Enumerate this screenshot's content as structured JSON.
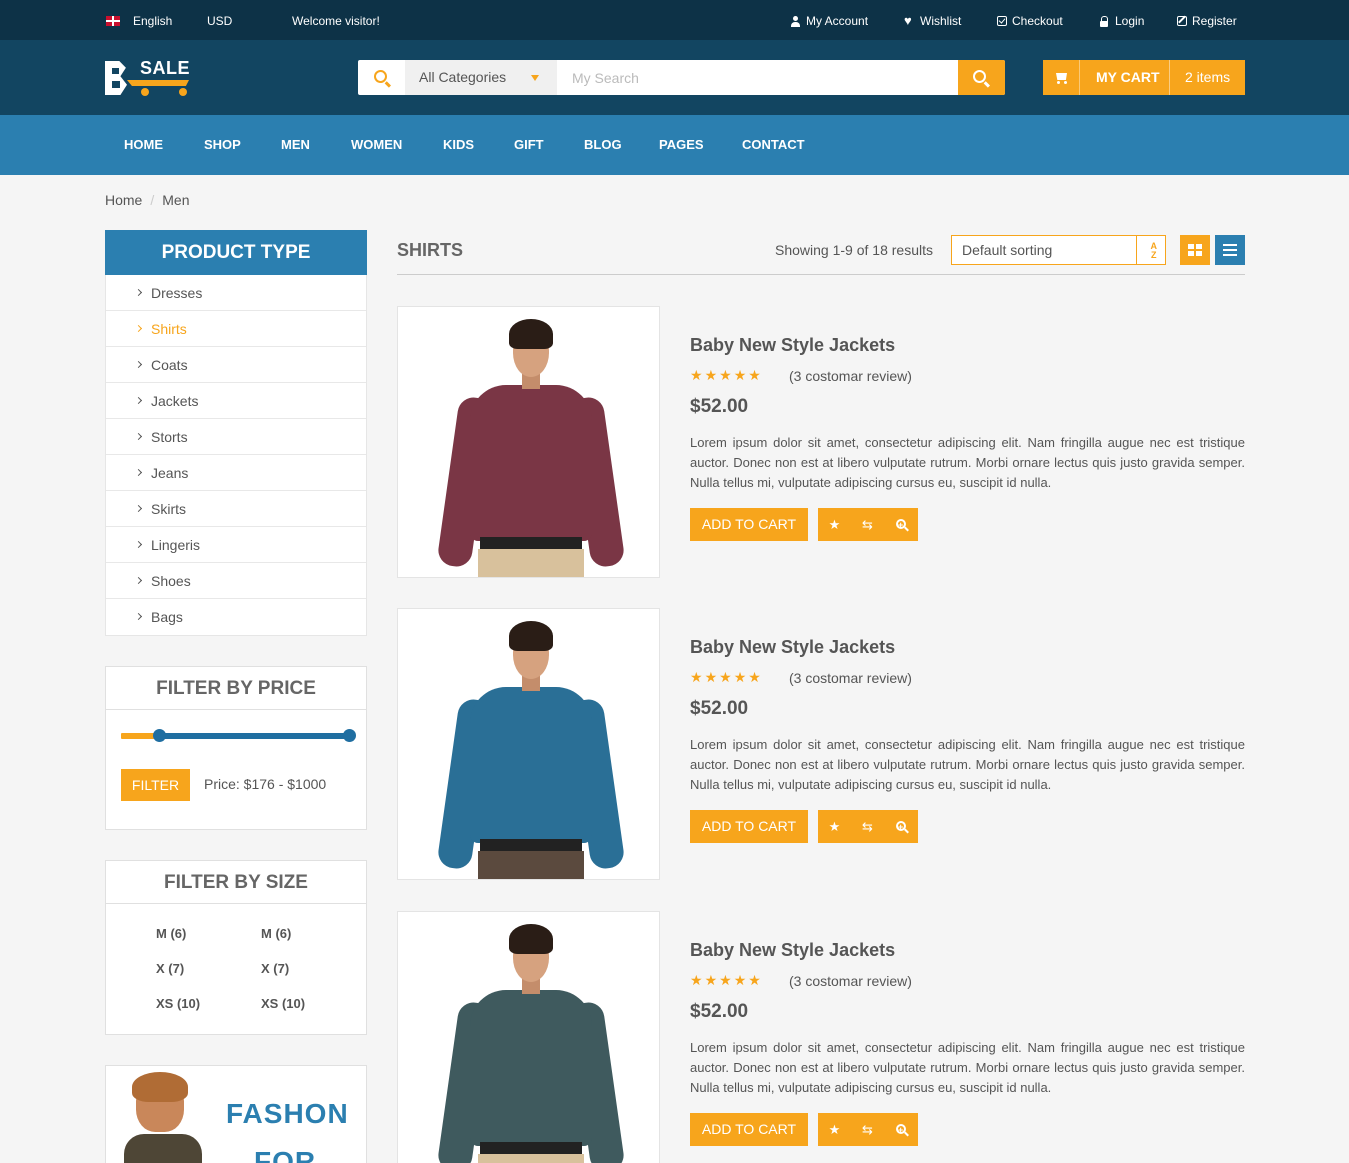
{
  "topbar": {
    "language": "English",
    "currency": "USD",
    "welcome": "Welcome visitor!",
    "links": [
      "My Account",
      "Wishlist",
      "Checkout",
      "Login",
      "Register"
    ]
  },
  "header": {
    "logo_text": "SALE",
    "search": {
      "category": "All Categories",
      "placeholder": "My Search"
    },
    "cart": {
      "label": "MY CART",
      "count": "2 items"
    }
  },
  "nav": [
    "HOME",
    "SHOP",
    "MEN",
    "WOMEN",
    "KIDS",
    "GIFT",
    "BLOG",
    "PAGES",
    "CONTACT"
  ],
  "breadcrumb": [
    "Home",
    "Men"
  ],
  "sidebar": {
    "product_type_title": "PRODUCT TYPE",
    "product_types": [
      "Dresses",
      "Shirts",
      "Coats",
      "Jackets",
      "Storts",
      "Jeans",
      "Skirts",
      "Lingeris",
      "Shoes",
      "Bags"
    ],
    "active_type": "Shirts",
    "price_filter": {
      "title": "FILTER BY PRICE",
      "button": "FILTER",
      "label": "Price: $176 - $1000",
      "range_fraction": [
        0.15,
        0.98
      ]
    },
    "size_filter": {
      "title": "FILTER BY SIZE",
      "sizes": [
        "M (6)",
        "M (6)",
        "X (7)",
        "X (7)",
        "XS (10)",
        "XS (10)"
      ]
    },
    "banner": {
      "line1": "FASHON",
      "line2": "FOR"
    }
  },
  "main": {
    "title": "SHIRTS",
    "showing": "Showing 1-9 of 18 results",
    "sort": "Default sorting",
    "products": [
      {
        "title": "Baby New Style Jackets",
        "rating": 5,
        "reviews": "(3 costomar review)",
        "price": "$52.00",
        "description": "Lorem ipsum dolor sit amet, consectetur adipiscing elit. Nam fringilla augue nec est tristique auctor. Donec non est at libero vulputate rutrum. Morbi ornare lectus quis justo gravida semper. Nulla tellus mi, vulputate adipiscing cursus eu, suscipit id nulla.",
        "button": "ADD TO CART",
        "shirt_color": "#7a3645"
      },
      {
        "title": "Baby New Style Jackets",
        "rating": 5,
        "reviews": "(3 costomar review)",
        "price": "$52.00",
        "description": "Lorem ipsum dolor sit amet, consectetur adipiscing elit. Nam fringilla augue nec est tristique auctor. Donec non est at libero vulputate rutrum. Morbi ornare lectus quis justo gravida semper. Nulla tellus mi, vulputate adipiscing cursus eu, suscipit id nulla.",
        "button": "ADD TO CART",
        "shirt_color": "#2a6f96"
      },
      {
        "title": "Baby New Style Jackets",
        "rating": 5,
        "reviews": "(3 costomar review)",
        "price": "$52.00",
        "description": "Lorem ipsum dolor sit amet, consectetur adipiscing elit. Nam fringilla augue nec est tristique auctor. Donec non est at libero vulputate rutrum. Morbi ornare lectus quis justo gravida semper. Nulla tellus mi, vulputate adipiscing cursus eu, suscipit id nulla.",
        "button": "ADD TO CART",
        "shirt_color": "#3f5a5e"
      }
    ]
  },
  "colors": {
    "accent": "#f7a51c",
    "primary": "#2b7fb0",
    "dark": "#0d3247",
    "header": "#124561"
  },
  "icons": [
    "flag-uk-icon",
    "user-icon",
    "heart-icon",
    "check-icon",
    "lock-icon",
    "edit-icon",
    "search-icon",
    "caret-down-icon",
    "cart-icon",
    "chevron-right-icon",
    "star-icon",
    "compare-icon",
    "zoom-icon",
    "grid-view-icon",
    "list-view-icon",
    "sort-az-icon"
  ]
}
